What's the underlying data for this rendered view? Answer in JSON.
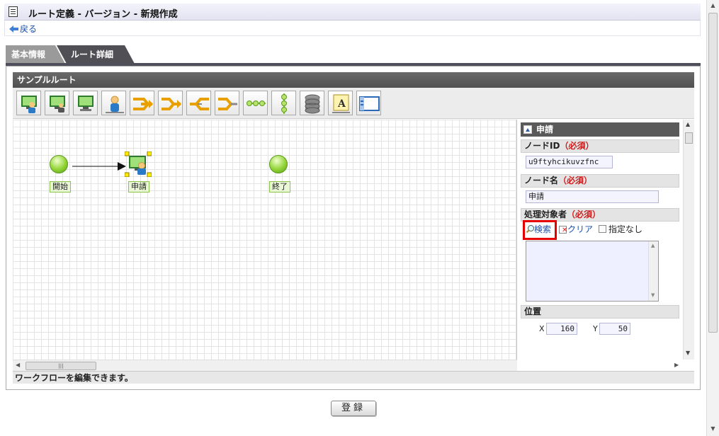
{
  "title": "ルート定義 - バージョン - 新規作成",
  "back_label": "戻る",
  "tabs": [
    {
      "label": "基本情報",
      "active": false
    },
    {
      "label": "ルート詳細",
      "active": true
    }
  ],
  "panel_title": "サンプルルート",
  "toolbar": [
    {
      "icon": "user-process-icon"
    },
    {
      "icon": "user-process-multi-icon"
    },
    {
      "icon": "system-process-icon"
    },
    {
      "icon": "person-icon"
    },
    {
      "icon": "split-icon"
    },
    {
      "icon": "merge-icon"
    },
    {
      "icon": "split-alt-icon"
    },
    {
      "icon": "merge-alt-icon"
    },
    {
      "icon": "horizontal-line-icon"
    },
    {
      "icon": "vertical-line-icon"
    },
    {
      "icon": "database-icon"
    },
    {
      "icon": "text-label-icon"
    },
    {
      "icon": "window-icon"
    }
  ],
  "nodes": {
    "start": "開始",
    "apply": "申請",
    "end": "終了"
  },
  "props": {
    "title": "申請",
    "node_id_label": "ノードID",
    "node_name_label": "ノード名",
    "target_label": "処理対象者",
    "required": "（必須）",
    "node_id_value": "u9ftyhcikuvzfnc",
    "node_name_value": "申請",
    "search_label": "検索",
    "clear_label": "クリア",
    "no_spec_label": "指定なし",
    "position_label": "位置",
    "x_label": "X",
    "y_label": "Y",
    "x_value": "160",
    "y_value": "50"
  },
  "status_text": "ワークフローを編集できます。",
  "register_label": "登録",
  "colors": {
    "tab_active": "#4f4f55",
    "node_green": "#92d436",
    "highlight_red": "#e60000"
  }
}
